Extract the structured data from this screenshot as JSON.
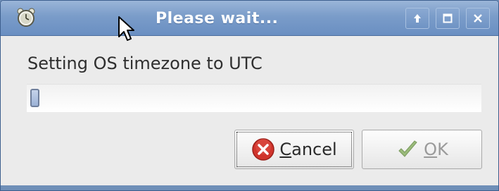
{
  "window": {
    "title": "Please wait...",
    "app_icon": "alarm-clock-icon",
    "controls": [
      {
        "name": "shade-up",
        "icon": "arrow-up-icon"
      },
      {
        "name": "maximize",
        "icon": "maximize-icon"
      },
      {
        "name": "close",
        "icon": "close-icon"
      }
    ]
  },
  "dialog": {
    "message": "Setting OS timezone to UTC",
    "progress_fraction": 0.02,
    "buttons": {
      "cancel": {
        "mnemonic": "C",
        "rest": "ancel",
        "icon": "cancel-icon",
        "enabled": true,
        "focused": true
      },
      "ok": {
        "mnemonic": "O",
        "rest": "K",
        "icon": "checkmark-icon",
        "enabled": false
      }
    }
  },
  "colors": {
    "titlebar": "#7a9cc9",
    "cancel_icon": "#d0342c",
    "ok_icon": "#9aba7a"
  }
}
